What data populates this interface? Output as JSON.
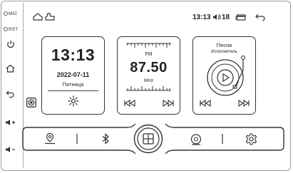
{
  "side_panel": {
    "mic_label": "MIC",
    "rst_label": "RST",
    "buttons": [
      "power-icon",
      "home-icon",
      "back-icon",
      "volume-up-icon",
      "volume-down-icon"
    ]
  },
  "status_bar": {
    "time": "13:13",
    "volume_level": "18",
    "icons": [
      "home-icon",
      "car-icon",
      "volume-icon",
      "window-icon",
      "back-icon"
    ]
  },
  "clock_widget": {
    "time": "13:13",
    "date": "2022-07-11",
    "weekday": "Пятница"
  },
  "radio_widget": {
    "band": "FM",
    "frequency": "87.50",
    "unit": "MHz"
  },
  "music_widget": {
    "song": "Песни",
    "artist": "Исполнитель"
  },
  "dock": {
    "items": [
      "navigation-icon",
      "bluetooth-icon",
      "apps-grid-icon",
      "music-disc-icon",
      "settings-icon"
    ]
  },
  "colors": {
    "line": "#333333",
    "frame": "#9a9a9a",
    "background": "#ffffff"
  }
}
